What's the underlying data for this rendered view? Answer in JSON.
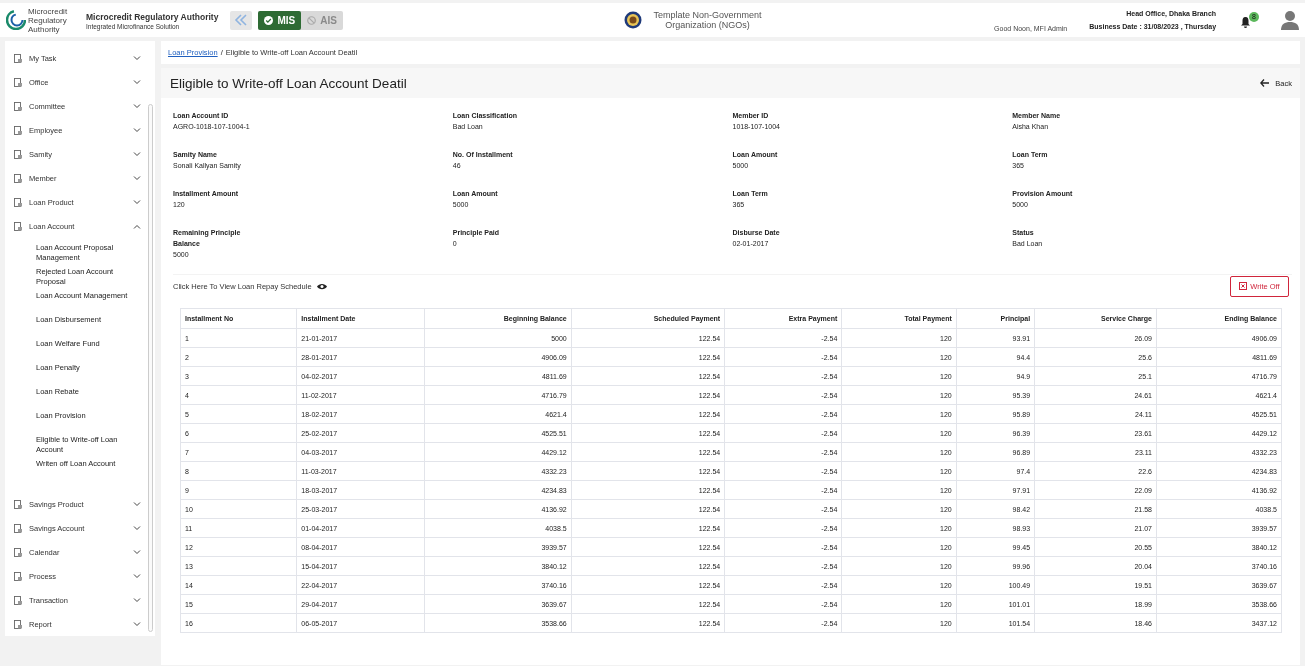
{
  "header": {
    "logo_text": "Microcredit Regulatory Authority",
    "org_name": "Microcredit Regulatory Authority",
    "app_name": "Integrated Microfinance Solution",
    "modules": [
      {
        "label": "MIS",
        "selected": true
      },
      {
        "label": "AIS",
        "selected": false
      }
    ],
    "ngo_name": "Template Non-Government Organization (NGOs)",
    "greeting": "Good Noon, MFI Admin",
    "branch": "Head Office, Dhaka Branch",
    "business_date": "Business Date : 31/08/2023 , Thursday",
    "notification_count": "8"
  },
  "sidebar": {
    "items": [
      {
        "label": "My Task",
        "expanded": false
      },
      {
        "label": "Office",
        "expanded": false
      },
      {
        "label": "Committee",
        "expanded": false
      },
      {
        "label": "Employee",
        "expanded": false
      },
      {
        "label": "Samity",
        "expanded": false
      },
      {
        "label": "Member",
        "expanded": false
      },
      {
        "label": "Loan Product",
        "expanded": false
      },
      {
        "label": "Loan Account",
        "expanded": true,
        "children": [
          {
            "label": "Loan Account Proposal Management"
          },
          {
            "label": "Rejected Loan Account Proposal"
          },
          {
            "label": "Loan Account Management"
          },
          {
            "label": "Loan Disbursement"
          },
          {
            "label": "Loan Welfare Fund"
          },
          {
            "label": "Loan Penalty"
          },
          {
            "label": "Loan Rebate"
          },
          {
            "label": "Loan Provision"
          },
          {
            "label": "Eligible to Write-off Loan Account"
          },
          {
            "label": "Writen off Loan Account"
          }
        ]
      },
      {
        "label": "Savings Product",
        "expanded": false
      },
      {
        "label": "Savings Account",
        "expanded": false
      },
      {
        "label": "Calendar",
        "expanded": false
      },
      {
        "label": "Process",
        "expanded": false
      },
      {
        "label": "Transaction",
        "expanded": false
      },
      {
        "label": "Report",
        "expanded": false
      }
    ]
  },
  "breadcrumb": [
    {
      "label": "Loan Provision",
      "kind": "link"
    },
    {
      "label": "/",
      "kind": "separator"
    },
    {
      "label": "Eligible to Write-off Loan Account Deatil",
      "kind": "current"
    }
  ],
  "page_title": "Eligible to Write-off Loan Account Deatil",
  "back_button": "Back",
  "details": [
    {
      "label": "Loan Account ID",
      "value": "AGRO-1018-107-1004-1"
    },
    {
      "label": "Loan Classification",
      "value": "Bad Loan"
    },
    {
      "label": "Member ID",
      "value": "1018-107-1004"
    },
    {
      "label": "Member Name",
      "value": "Aisha Khan"
    },
    {
      "label": "Samity Name",
      "value": "Sonali Kallyan Samity"
    },
    {
      "label": "No. Of Installment",
      "value": "46"
    },
    {
      "label": "Loan Amount",
      "value": "5000"
    },
    {
      "label": "Loan Term",
      "value": "365"
    },
    {
      "label": "Installment Amount",
      "value": "120"
    },
    {
      "label": "Loan Amount",
      "value": "5000"
    },
    {
      "label": "Loan Term",
      "value": "365"
    },
    {
      "label": "Provision Amount",
      "value": "5000"
    },
    {
      "label": "Remaining Principle Balance",
      "value": "5000"
    },
    {
      "label": "Principle Paid",
      "value": "0"
    },
    {
      "label": "Disburse Date",
      "value": "02-01-2017"
    },
    {
      "label": "Status",
      "value": "Bad Loan"
    }
  ],
  "schedule_link": "Click Here To View Loan Repay Schedule",
  "write_off_button": "Write Off",
  "table": {
    "columns": [
      "Installment No",
      "Installment Date",
      "Beginning Balance",
      "Scheduled Payment",
      "Extra Payment",
      "Total Payment",
      "Principal",
      "Service Charge",
      "Ending Balance"
    ],
    "rows": [
      [
        "1",
        "21-01-2017",
        "5000",
        "122.54",
        "-2.54",
        "120",
        "93.91",
        "26.09",
        "4906.09"
      ],
      [
        "2",
        "28-01-2017",
        "4906.09",
        "122.54",
        "-2.54",
        "120",
        "94.4",
        "25.6",
        "4811.69"
      ],
      [
        "3",
        "04-02-2017",
        "4811.69",
        "122.54",
        "-2.54",
        "120",
        "94.9",
        "25.1",
        "4716.79"
      ],
      [
        "4",
        "11-02-2017",
        "4716.79",
        "122.54",
        "-2.54",
        "120",
        "95.39",
        "24.61",
        "4621.4"
      ],
      [
        "5",
        "18-02-2017",
        "4621.4",
        "122.54",
        "-2.54",
        "120",
        "95.89",
        "24.11",
        "4525.51"
      ],
      [
        "6",
        "25-02-2017",
        "4525.51",
        "122.54",
        "-2.54",
        "120",
        "96.39",
        "23.61",
        "4429.12"
      ],
      [
        "7",
        "04-03-2017",
        "4429.12",
        "122.54",
        "-2.54",
        "120",
        "96.89",
        "23.11",
        "4332.23"
      ],
      [
        "8",
        "11-03-2017",
        "4332.23",
        "122.54",
        "-2.54",
        "120",
        "97.4",
        "22.6",
        "4234.83"
      ],
      [
        "9",
        "18-03-2017",
        "4234.83",
        "122.54",
        "-2.54",
        "120",
        "97.91",
        "22.09",
        "4136.92"
      ],
      [
        "10",
        "25-03-2017",
        "4136.92",
        "122.54",
        "-2.54",
        "120",
        "98.42",
        "21.58",
        "4038.5"
      ],
      [
        "11",
        "01-04-2017",
        "4038.5",
        "122.54",
        "-2.54",
        "120",
        "98.93",
        "21.07",
        "3939.57"
      ],
      [
        "12",
        "08-04-2017",
        "3939.57",
        "122.54",
        "-2.54",
        "120",
        "99.45",
        "20.55",
        "3840.12"
      ],
      [
        "13",
        "15-04-2017",
        "3840.12",
        "122.54",
        "-2.54",
        "120",
        "99.96",
        "20.04",
        "3740.16"
      ],
      [
        "14",
        "22-04-2017",
        "3740.16",
        "122.54",
        "-2.54",
        "120",
        "100.49",
        "19.51",
        "3639.67"
      ],
      [
        "15",
        "29-04-2017",
        "3639.67",
        "122.54",
        "-2.54",
        "120",
        "101.01",
        "18.99",
        "3538.66"
      ],
      [
        "16",
        "06-05-2017",
        "3538.66",
        "122.54",
        "-2.54",
        "120",
        "101.54",
        "18.46",
        "3437.12"
      ]
    ]
  }
}
